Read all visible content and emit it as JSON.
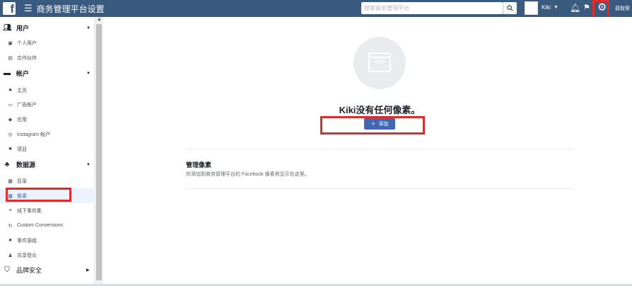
{
  "topbar": {
    "title": "商务管理平台设置",
    "search_placeholder": "搜索商务管理平台",
    "profile_name": "Kiki",
    "more_label": "获取帮"
  },
  "sidebar": {
    "sections": [
      {
        "label": "用户",
        "icon": "users-icon",
        "items": [
          {
            "label": "个人用户",
            "icon": "person-card-icon"
          },
          {
            "label": "合作伙伴",
            "icon": "briefcase-icon"
          }
        ]
      },
      {
        "label": "帐户",
        "icon": "archive-icon",
        "items": [
          {
            "label": "主页",
            "icon": "flag-icon"
          },
          {
            "label": "广告帐户",
            "icon": "ad-account-icon"
          },
          {
            "label": "应用",
            "icon": "cube-icon"
          },
          {
            "label": "Instagram 帐户",
            "icon": "instagram-icon"
          },
          {
            "label": "项目",
            "icon": "folder-icon"
          }
        ]
      },
      {
        "label": "数据源",
        "icon": "data-sources-icon",
        "items": [
          {
            "label": "目录",
            "icon": "grid-icon"
          },
          {
            "label": "像素",
            "icon": "pixel-icon",
            "active": true
          },
          {
            "label": "线下事件集",
            "icon": "stack-icon"
          },
          {
            "label": "Custom Conversions",
            "icon": "refresh-icon"
          },
          {
            "label": "事件源组",
            "icon": "group-icon"
          },
          {
            "label": "共享受众",
            "icon": "shared-audience-icon"
          }
        ]
      },
      {
        "label": "品牌安全",
        "icon": "shield-icon"
      }
    ]
  },
  "main": {
    "headline": "Kiki没有任何像素。",
    "add_button_label": "添加",
    "section_title": "管理像素",
    "section_desc": "你添加到商务管理平台的 Facebook 像素将显示在这里。"
  },
  "colors": {
    "topbar": "#3b5a80",
    "accent": "#4267b2",
    "highlight": "#e02b2b"
  }
}
